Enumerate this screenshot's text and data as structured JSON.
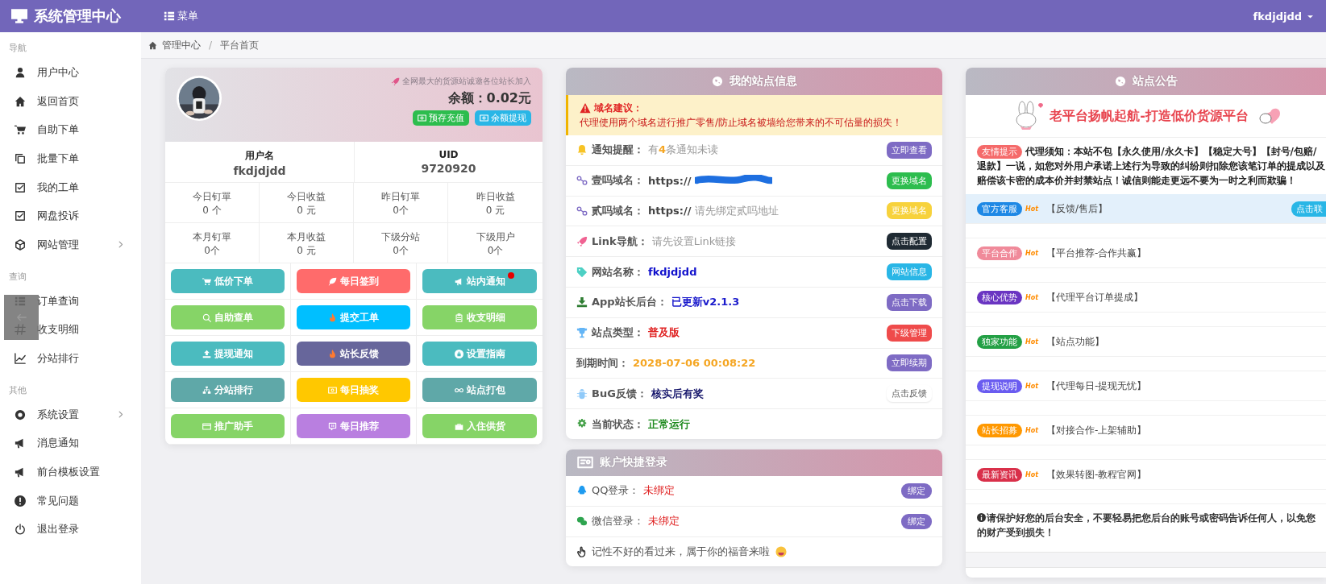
{
  "topbar": {
    "title": "系统管理中心",
    "menu_label": "菜单",
    "user": "fkdjdjdd"
  },
  "sidebar": {
    "sections": [
      {
        "heading": "导航",
        "items": [
          {
            "label": "用户中心",
            "has_submenu": false
          },
          {
            "label": "返回首页",
            "has_submenu": false
          },
          {
            "label": "自助下单",
            "has_submenu": false
          },
          {
            "label": "批量下单",
            "has_submenu": false
          },
          {
            "label": "我的工单",
            "has_submenu": false
          },
          {
            "label": "网盘投诉",
            "has_submenu": false
          },
          {
            "label": "网站管理",
            "has_submenu": true
          }
        ]
      },
      {
        "heading": "查询",
        "items": [
          {
            "label": "订单查询",
            "has_submenu": false
          },
          {
            "label": "收支明细",
            "has_submenu": false
          },
          {
            "label": "分站排行",
            "has_submenu": false
          }
        ]
      },
      {
        "heading": "其他",
        "items": [
          {
            "label": "系统设置",
            "has_submenu": true
          },
          {
            "label": "消息通知",
            "has_submenu": false
          },
          {
            "label": "前台模板设置",
            "has_submenu": false
          },
          {
            "label": "常见问题",
            "has_submenu": false
          },
          {
            "label": "退出登录",
            "has_submenu": false
          }
        ]
      }
    ]
  },
  "breadcrumb": {
    "items": [
      "管理中心",
      "平台首页"
    ],
    "separator": "/"
  },
  "profile": {
    "promo": "全网最大的货源站诚邀各位站长加入",
    "balance": "余额：0.02元",
    "actions": [
      {
        "label": "预存充值",
        "color": "#2dbd4e"
      },
      {
        "label": "余额提现",
        "color": "#29b6e6"
      }
    ],
    "user_fields": [
      {
        "label": "用户名",
        "value": "fkdjdjdd"
      },
      {
        "label": "UID",
        "value": "9720920"
      }
    ],
    "stats": [
      {
        "label": "今日钉單",
        "value": "0 个"
      },
      {
        "label": "今日收益",
        "value": "0 元"
      },
      {
        "label": "昨日钉單",
        "value": "0个"
      },
      {
        "label": "昨日收益",
        "value": "0 元"
      },
      {
        "label": "本月钉單",
        "value": "0个"
      },
      {
        "label": "本月收益",
        "value": "0 元"
      },
      {
        "label": "下级分站",
        "value": "0个"
      },
      {
        "label": "下级用户",
        "value": "0个"
      }
    ],
    "buttons": [
      {
        "label": "低价下单",
        "color": "#4bbbbf",
        "notification": false
      },
      {
        "label": "每日签到",
        "color": "#ff6b6b",
        "notification": false
      },
      {
        "label": "站内通知",
        "color": "#4bbbbf",
        "notification": true
      },
      {
        "label": "自助查单",
        "color": "#86d467",
        "notification": false
      },
      {
        "label": "提交工单",
        "color": "#00bfff",
        "notification": false
      },
      {
        "label": "收支明细",
        "color": "#86d467",
        "notification": false
      },
      {
        "label": "提现通知",
        "color": "#4bbbbf",
        "notification": false
      },
      {
        "label": "站长反馈",
        "color": "#67669b",
        "notification": false
      },
      {
        "label": "设置指南",
        "color": "#4bbbbf",
        "notification": false
      },
      {
        "label": "分站排行",
        "color": "#5fa8a8",
        "notification": false
      },
      {
        "label": "每日抽奖",
        "color": "#ffc800",
        "notification": false
      },
      {
        "label": "站点打包",
        "color": "#5fa8a8",
        "notification": false
      },
      {
        "label": "推广助手",
        "color": "#86d467",
        "notification": false
      },
      {
        "label": "每日推荐",
        "color": "#b97fe0",
        "notification": false
      },
      {
        "label": "入住供货",
        "color": "#86d467",
        "notification": false
      }
    ]
  },
  "site_info": {
    "title": "我的站点信息",
    "alert": {
      "title": "域名建议：",
      "text": "代理使用两个域名进行推广零售/防止域名被墙给您带来的不可估量的损失！"
    },
    "rows": [
      {
        "label": "通知提醒：",
        "kind": "hint",
        "value": "有**4**条通知未读",
        "color": "#999999",
        "action": {
          "kind": "filled",
          "label": "立即查看",
          "color": "#7e6bc4"
        }
      },
      {
        "label": "壹吗域名：",
        "kind": "redacted",
        "prefix": "https://",
        "action": {
          "kind": "filled",
          "label": "更换域名",
          "color": "#2dbd4e"
        }
      },
      {
        "label": "贰吗域名：",
        "prefix": "https://",
        "kind": "hint",
        "value": "请先绑定贰吗地址",
        "color": "#999999",
        "action": {
          "kind": "filled",
          "label": "更换域名",
          "color": "#f7d23c"
        }
      },
      {
        "label": "Link导航：",
        "kind": "hint",
        "value": "请先设置Link链接",
        "color": "#999999",
        "action": {
          "kind": "filled",
          "label": "点击配置",
          "color": "#1f2a33"
        }
      },
      {
        "label": "网站名称：",
        "kind": "emphasis",
        "value": "fkdjdjdd",
        "color": "#1010cc",
        "action": {
          "kind": "filled",
          "label": "网站信息",
          "color": "#29b6e6"
        }
      },
      {
        "label": "App站长后台：",
        "kind": "emphasis",
        "value": "已更新v2.1.3",
        "color": "#1a1acc",
        "action": {
          "kind": "filled",
          "label": "点击下载",
          "color": "#7e6bc4"
        }
      },
      {
        "label": "站点类型：",
        "kind": "emphasis",
        "value": "普及版",
        "color": "#e02424",
        "action": {
          "kind": "filled",
          "label": "下级管理",
          "color": "#ef4b4b"
        }
      },
      {
        "label": "到期时间：",
        "kind": "emphasis",
        "value": "2028-07-06 00:08:22",
        "color": "#f5a623",
        "action": {
          "kind": "filled",
          "label": "立即续期",
          "color": "#7e6bc4"
        }
      },
      {
        "label": "BuG反馈：",
        "kind": "emphasis",
        "value": "核实后有奖",
        "color": "#1a1a6e",
        "action": {
          "kind": "plain",
          "label": "点击反馈"
        }
      },
      {
        "label": "当前状态：",
        "kind": "emphasis",
        "value": "正常运行",
        "color": "#1e8a1e"
      }
    ]
  },
  "quick_login": {
    "title": "账户快捷登录",
    "rows": [
      {
        "label": "QQ登录：",
        "value": "未绑定",
        "action": "绑定"
      },
      {
        "label": "微信登录：",
        "value": "未绑定",
        "action": "绑定"
      }
    ],
    "note": "记性不好的看过来，属于你的福音来啦"
  },
  "announcements": {
    "title": "站点公告",
    "banner": "老平台扬帆起航-打造低价货源平台",
    "notice": {
      "tag": "友情提示",
      "text": "代理须知：本站不包【永久使用/永久卡】【稳定大号】【封号/包赔/退款】一说，如您对外用户承诺上述行为导致的纠纷则扣除您该笔订单的提成以及赔偿该卡密的成本价并封禁站点！诚信则能走更远不要为一时之利而欺骗！"
    },
    "items": [
      {
        "tag": "官方客服",
        "color": "#1e88e5",
        "hot": "Hot",
        "text": "【反馈/售后】",
        "highlighted": true,
        "action": "点击联"
      },
      {
        "tag": "平台合作",
        "color": "#f08a9a",
        "hot": "Hot",
        "text": "【平台推荐-合作共赢】",
        "highlighted": false
      },
      {
        "tag": "核心优势",
        "color": "#6a35c2",
        "hot": "Hot",
        "text": "【代理平台订单提成】",
        "highlighted": false
      },
      {
        "tag": "独家功能",
        "color": "#23a045",
        "hot": "Hot",
        "text": "【站点功能】",
        "highlighted": false
      },
      {
        "tag": "提现说明",
        "color": "#6a5cf0",
        "hot": "Hot",
        "text": "【代理每日-提现无忧】",
        "highlighted": false
      },
      {
        "tag": "站长招募",
        "color": "#ff9800",
        "hot": "Hot",
        "text": "【对接合作-上架辅助】",
        "highlighted": false
      },
      {
        "tag": "最新资讯",
        "color": "#d9304a",
        "hot": "Hot",
        "text": "【效果转图-教程官网】",
        "highlighted": false
      }
    ],
    "security": "请保护好您的后台安全，不要轻易把您后台的账号或密码告诉任何人，以免您的财产受到损失！"
  }
}
